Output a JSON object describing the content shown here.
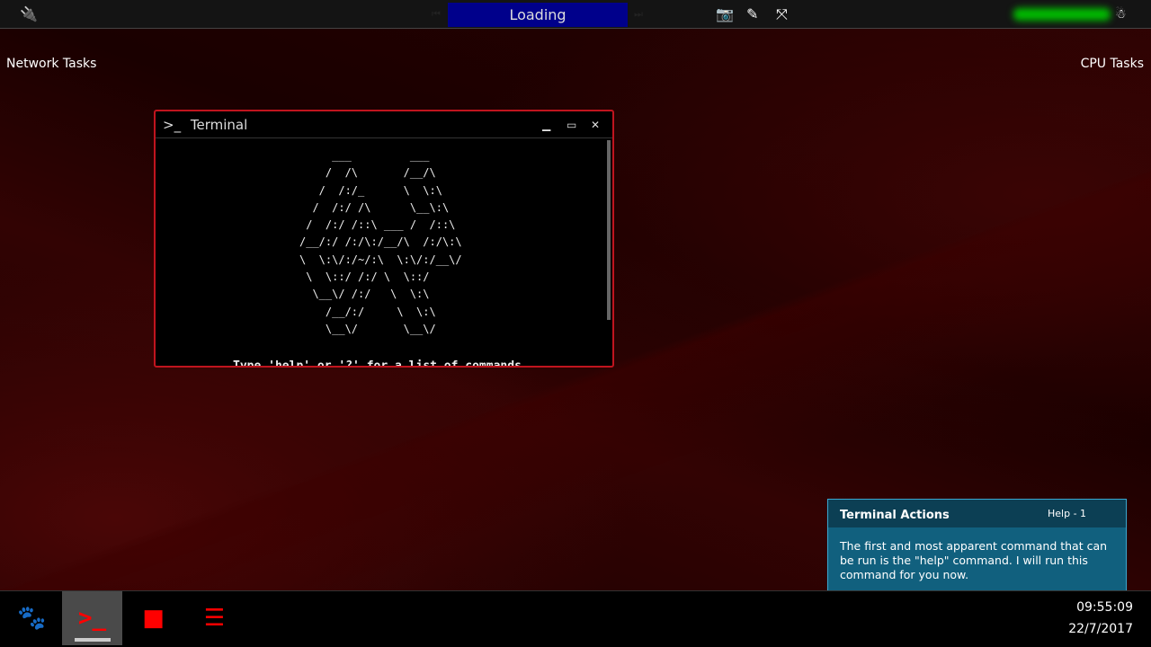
{
  "topbar": {
    "status": "Loading",
    "icons": [
      "plug-icon",
      "skip-back-icon",
      "skip-forward-icon",
      "camera-icon",
      "mic-off-icon",
      "fullscreen-icon",
      "user-icon"
    ]
  },
  "labels": {
    "network_tasks": "Network Tasks",
    "cpu_tasks": "CPU Tasks"
  },
  "terminal": {
    "prompt_icon": ">_",
    "title": "Terminal",
    "ascii_art": "     ___         ___\n    /  /\\       /__/\\\n   /  /:/_      \\  \\:\\\n  /  /:/ /\\      \\__\\:\\\n /  /:/ /::\\ ___ /  /::\\\n/__/:/ /:/\\:/__/\\  /:/\\:\\\n\\  \\:\\/:/~/:\\  \\:\\/:/__\\/\n \\  \\::/ /:/ \\  \\::/\n  \\__\\/ /:/   \\  \\:\\\n    /__/:/     \\  \\:\\\n    \\__\\/       \\__\\/",
    "hint": "Type 'help' or '?' for a list of commands"
  },
  "taskbar": {
    "items": [
      "paw-icon",
      "terminal-icon",
      "folder-icon",
      "list-icon"
    ],
    "active": "terminal-icon",
    "time": "09:55:09",
    "date": "22/7/2017"
  },
  "help": {
    "title": "Terminal Actions",
    "counter": "Help - 1",
    "text": "The first and most apparent command that can be run is the \"help\" command. I will run this command for you now."
  },
  "colors": {
    "accent": "#ff0000",
    "loading_bg": "#00008b",
    "help_bg": "#11607e",
    "border": "#c0141e"
  }
}
